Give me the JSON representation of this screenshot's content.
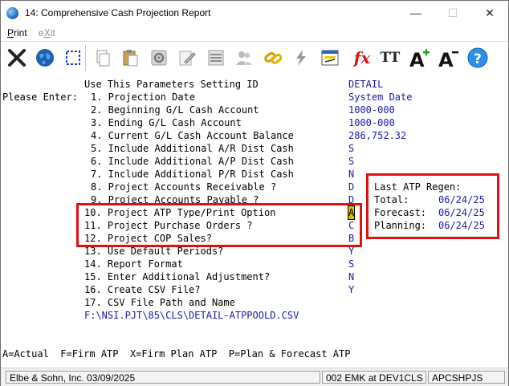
{
  "window": {
    "title": "14: Comprehensive Cash Projection Report",
    "minimize": "—",
    "maximize": "☐",
    "close": "✕"
  },
  "menu": {
    "print": "Print",
    "exit": "eXit"
  },
  "toolbar": {
    "icons": [
      "exit-x-icon",
      "globe-icon",
      "select-box-icon",
      "copy-icon",
      "paste-icon",
      "settings-gear-icon",
      "edit-icon",
      "list-icon",
      "users-icon",
      "chain-link-icon",
      "lightning-icon",
      "calculator-window-icon",
      "fx-formula-icon",
      "text-style-icon",
      "font-increase-icon",
      "font-decrease-icon",
      "help-icon"
    ],
    "fx_label": "fx",
    "tt_label": "TT",
    "help_label": "?"
  },
  "screen": {
    "header_label": "Use This Parameters Setting ID",
    "header_value": "DETAIL",
    "please_enter": "Please Enter:",
    "params": [
      {
        "label": "1. Projection Date",
        "value": "System Date"
      },
      {
        "label": "2. Beginning G/L Cash Account",
        "value": "1000-000"
      },
      {
        "label": "3. Ending G/L Cash Account",
        "value": "1000-000"
      },
      {
        "label": "4. Current G/L Cash Account Balance",
        "value": "286,752.32"
      },
      {
        "label": "5. Include Additional A/R Dist Cash",
        "value": "S"
      },
      {
        "label": "6. Include Additional A/P Dist Cash",
        "value": "S"
      },
      {
        "label": "7. Include Additional P/R Dist Cash",
        "value": "N"
      },
      {
        "label": "8. Project Accounts Receivable ?",
        "value": "D"
      },
      {
        "label": "9. Project Accounts Payable ?",
        "value": "D"
      },
      {
        "label": "10. Project ATP Type/Print Option",
        "value": "A"
      },
      {
        "label": "11. Project Purchase Orders ?",
        "value": "C"
      },
      {
        "label": "12. Project COP Sales?",
        "value": "B"
      },
      {
        "label": "13. Use Default Periods?",
        "value": "Y"
      },
      {
        "label": "14. Report Format",
        "value": "S"
      },
      {
        "label": "15. Enter Additional Adjustment?",
        "value": "N"
      },
      {
        "label": "16. Create CSV File?",
        "value": "Y"
      },
      {
        "label": "17. CSV File Path and Name",
        "value": ""
      }
    ],
    "csv_path": "F:\\NSI.PJT\\85\\CLS\\DETAIL-ATPPOOLD.CSV",
    "atp_box": {
      "title": "Last ATP Regen:",
      "rows": [
        {
          "label": "Total:",
          "value": "06/24/25"
        },
        {
          "label": "Forecast:",
          "value": "06/24/25"
        },
        {
          "label": "Planning:",
          "value": "06/24/25"
        }
      ]
    },
    "help_line": "A=Actual  F=Firm ATP  X=Firm Plan ATP  P=Plan & Forecast ATP"
  },
  "status": {
    "company": "Elbe & Sohn, Inc. 03/09/2025",
    "user": "002 EMK at DEV1CLS",
    "program": "APCSHPJS"
  },
  "colors": {
    "value_text": "#1a1aa8",
    "highlight": "#e01010",
    "cursor": "#d8c200"
  }
}
